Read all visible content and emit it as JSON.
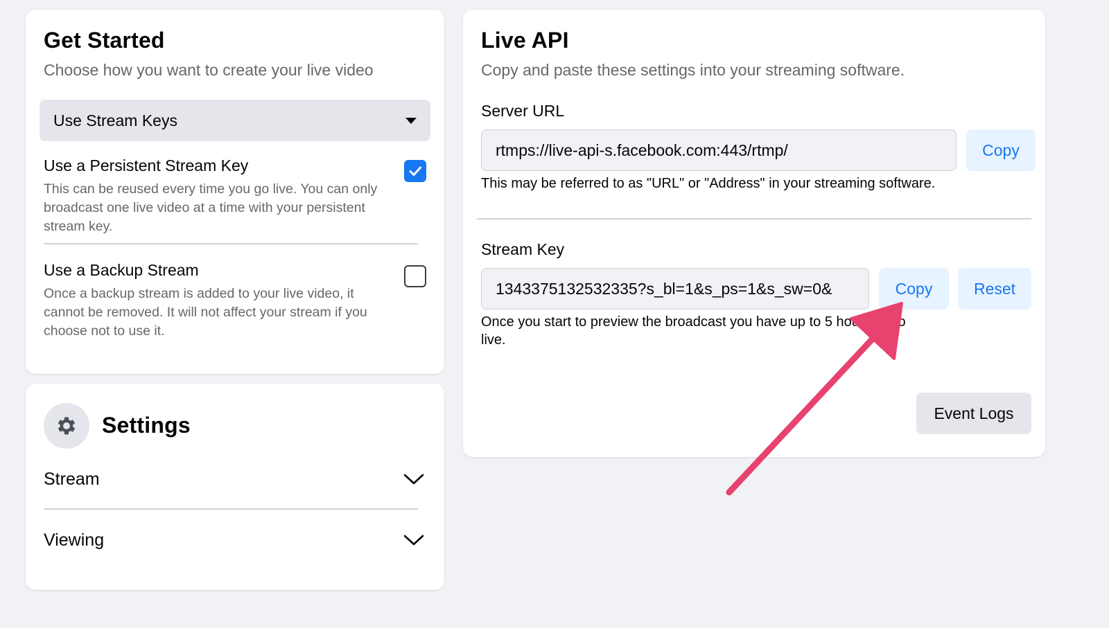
{
  "get_started": {
    "title": "Get Started",
    "subtitle": "Choose how you want to create your live video",
    "dropdown_value": "Use Stream Keys",
    "options": [
      {
        "title": "Use a Persistent Stream Key",
        "description": "This can be reused every time you go live. You can only broadcast one live video at a time with your persistent stream key.",
        "checked": true
      },
      {
        "title": "Use a Backup Stream",
        "description": "Once a backup stream is added to your live video, it cannot be removed. It will not affect your stream if you choose not to use it.",
        "checked": false
      }
    ]
  },
  "settings": {
    "title": "Settings",
    "icon": "gear-icon",
    "rows": [
      {
        "label": "Stream"
      },
      {
        "label": "Viewing"
      }
    ]
  },
  "live_api": {
    "title": "Live API",
    "subtitle": "Copy and paste these settings into your streaming software.",
    "server_url": {
      "label": "Server URL",
      "value": "rtmps://live-api-s.facebook.com:443/rtmp/",
      "copy_label": "Copy",
      "hint": "This may be referred to as \"URL\" or \"Address\" in your streaming software."
    },
    "stream_key": {
      "label": "Stream Key",
      "value": "1343375132532335?s_bl=1&s_ps=1&s_sw=0&",
      "copy_label": "Copy",
      "reset_label": "Reset",
      "hint_line1": "Once you start to preview the broadcast you have up to 5 hours to go",
      "hint_line2": "live."
    },
    "event_logs_label": "Event Logs"
  },
  "colors": {
    "accent": "#1877f2",
    "annotation_arrow": "#e8436f"
  }
}
